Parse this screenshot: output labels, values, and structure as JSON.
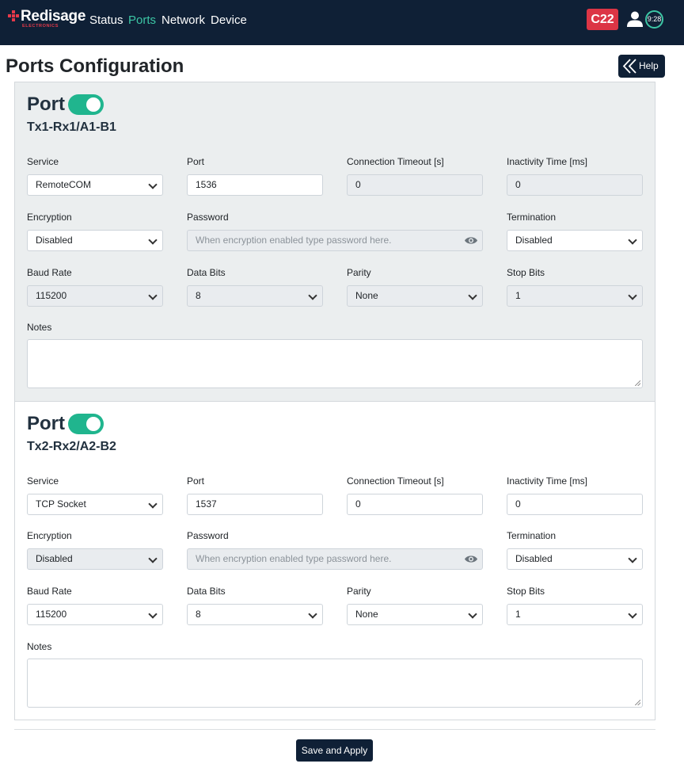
{
  "nav": {
    "brand": "Redisage",
    "brand_sub": "ELECTRONICS",
    "links": [
      "Status",
      "Ports",
      "Network",
      "Device"
    ],
    "active": "Ports",
    "badge": "C22",
    "clock": "9:28",
    "user_icon": "user-icon"
  },
  "header": {
    "title": "Ports Configuration",
    "help_label": "Help"
  },
  "ports": [
    {
      "title": "Port",
      "enabled": true,
      "subtitle": "Tx1-Rx1/A1-B1",
      "labels": {
        "service": "Service",
        "port": "Port",
        "timeout": "Connection Timeout [s]",
        "inactivity": "Inactivity Time [ms]",
        "encryption": "Encryption",
        "password": "Password",
        "termination": "Termination",
        "baud": "Baud Rate",
        "databits": "Data Bits",
        "parity": "Parity",
        "stopbits": "Stop Bits",
        "notes": "Notes"
      },
      "values": {
        "service": "RemoteCOM",
        "port": "1536",
        "timeout": "0",
        "inactivity": "0",
        "encryption": "Disabled",
        "password_placeholder": "When encryption enabled type password here.",
        "termination": "Disabled",
        "baud": "115200",
        "databits": "8",
        "parity": "None",
        "stopbits": "1",
        "notes": ""
      }
    },
    {
      "title": "Port",
      "enabled": true,
      "subtitle": "Tx2-Rx2/A2-B2",
      "labels": {
        "service": "Service",
        "port": "Port",
        "timeout": "Connection Timeout [s]",
        "inactivity": "Inactivity Time [ms]",
        "encryption": "Encryption",
        "password": "Password",
        "termination": "Termination",
        "baud": "Baud Rate",
        "databits": "Data Bits",
        "parity": "Parity",
        "stopbits": "Stop Bits",
        "notes": "Notes"
      },
      "values": {
        "service": "TCP Socket",
        "port": "1537",
        "timeout": "0",
        "inactivity": "0",
        "encryption": "Disabled",
        "password_placeholder": "When encryption enabled type password here.",
        "termination": "Disabled",
        "baud": "115200",
        "databits": "8",
        "parity": "None",
        "stopbits": "1",
        "notes": ""
      }
    }
  ],
  "footer": {
    "save_label": "Save and Apply"
  },
  "colors": {
    "navbar": "#0f2036",
    "accent": "#3cc6a5",
    "badge": "#dc3545",
    "toggle": "#20b58e"
  }
}
